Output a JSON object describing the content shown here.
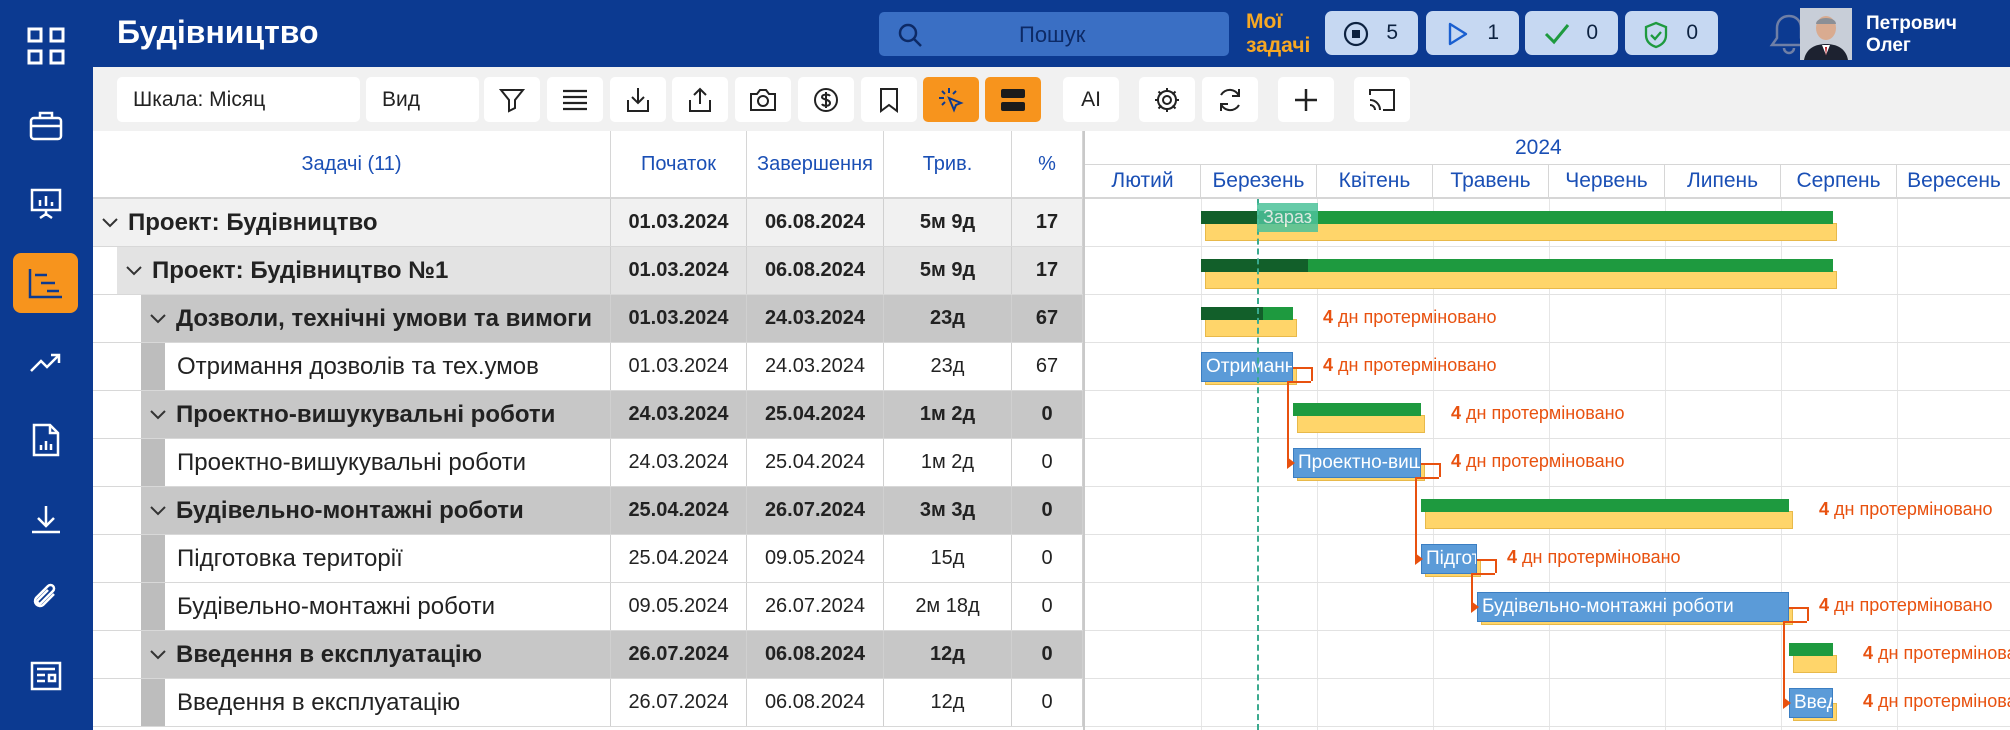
{
  "app": {
    "title": "Будівництво"
  },
  "search": {
    "placeholder": "Пошук"
  },
  "my_tasks": {
    "line1": "Мої",
    "line2": "задачі"
  },
  "counters": [
    {
      "icon": "stop-icon",
      "value": "5"
    },
    {
      "icon": "play-icon",
      "value": "1"
    },
    {
      "icon": "check-icon",
      "value": "0"
    },
    {
      "icon": "shield-check-icon",
      "value": "0"
    }
  ],
  "user": {
    "first": "Петрович",
    "second": "Олег"
  },
  "toolbar": {
    "scale": "Шкала: Місяц",
    "view": "Вид",
    "ai": "AI"
  },
  "grid": {
    "headers": {
      "tasks": "Задачі (11)",
      "start": "Початок",
      "end": "Завершення",
      "duration": "Трив.",
      "percent": "%"
    },
    "rows": [
      {
        "name": "Проект: Будівництво",
        "start": "01.03.2024",
        "end": "06.08.2024",
        "duration": "5м 9д",
        "percent": "17"
      },
      {
        "name": "Проект: Будівництво №1",
        "start": "01.03.2024",
        "end": "06.08.2024",
        "duration": "5м 9д",
        "percent": "17"
      },
      {
        "name": "Дозволи, технічні умови та вимоги",
        "start": "01.03.2024",
        "end": "24.03.2024",
        "duration": "23д",
        "percent": "67"
      },
      {
        "name": "Отримання дозволів та тех.умов",
        "start": "01.03.2024",
        "end": "24.03.2024",
        "duration": "23д",
        "percent": "67"
      },
      {
        "name": "Проектно-вишукувальні роботи",
        "start": "24.03.2024",
        "end": "25.04.2024",
        "duration": "1м 2д",
        "percent": "0"
      },
      {
        "name": "Проектно-вишукувальні роботи",
        "start": "24.03.2024",
        "end": "25.04.2024",
        "duration": "1м 2д",
        "percent": "0"
      },
      {
        "name": "Будівельно-монтажні роботи",
        "start": "25.04.2024",
        "end": "26.07.2024",
        "duration": "3м 3д",
        "percent": "0"
      },
      {
        "name": "Підготовка території",
        "start": "25.04.2024",
        "end": "09.05.2024",
        "duration": "15д",
        "percent": "0"
      },
      {
        "name": "Будівельно-монтажні роботи",
        "start": "09.05.2024",
        "end": "26.07.2024",
        "duration": "2м 18д",
        "percent": "0"
      },
      {
        "name": "Введення в експлуатацію",
        "start": "26.07.2024",
        "end": "06.08.2024",
        "duration": "12д",
        "percent": "0"
      },
      {
        "name": "Введення в експлуатацію",
        "start": "26.07.2024",
        "end": "06.08.2024",
        "duration": "12д",
        "percent": "0"
      }
    ]
  },
  "gantt": {
    "year": "2024",
    "months": [
      "Лютий",
      "Березень",
      "Квітень",
      "Травень",
      "Червень",
      "Липень",
      "Серпень",
      "Вересень"
    ],
    "today_label": "Зараз",
    "late_count": "4",
    "late_text": "дн протерміновано",
    "bar_labels": [
      "Отримання дозволів та тех.умов",
      "Проектно-вишукувальні роботи",
      "Підготовка території",
      "Будівельно-монтажні роботи",
      "Введення в експлуатацію"
    ]
  },
  "colors": {
    "brand": "#0c3a91",
    "accent": "#f7941d",
    "progress": "#1e9a3f",
    "plan": "#ffd56a",
    "task": "#5b9bd8",
    "overdue": "#e8510f"
  }
}
